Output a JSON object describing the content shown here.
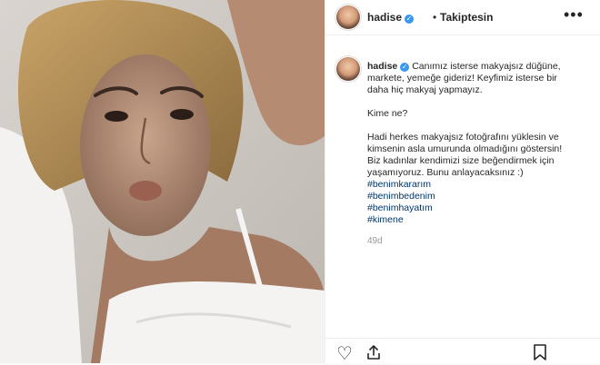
{
  "post": {
    "author": {
      "username": "hadise",
      "verified_icon": "verified-badge-icon",
      "separator": "•",
      "follow_state": "Takiptesin"
    },
    "caption": {
      "username": "hadise",
      "paragraph_1": "Canımız isterse makyajsız düğüne, markete, yemeğe gideriz! Keyfimiz isterse bir daha hiç makyaj yapmayız.",
      "paragraph_2": "Kime ne?",
      "paragraph_3": "Hadi herkes makyajsız fotoğrafını yüklesin ve kimsenin asla umurunda olmadığını göstersin! Biz kadınlar kendimizi size beğendirmek için yaşamıyoruz. Bunu anlayacaksınız :)",
      "hashtags": [
        "#benimkararım",
        "#benimbedenim",
        "#benimhayatım",
        "#kimene"
      ],
      "timestamp": "49d"
    },
    "actions": {
      "icons": [
        "heart-icon",
        "share-icon",
        "bookmark-icon"
      ]
    },
    "colors": {
      "verified": "#3897f0",
      "hashtag": "#003569",
      "text": "#262626",
      "muted": "#999999"
    }
  }
}
